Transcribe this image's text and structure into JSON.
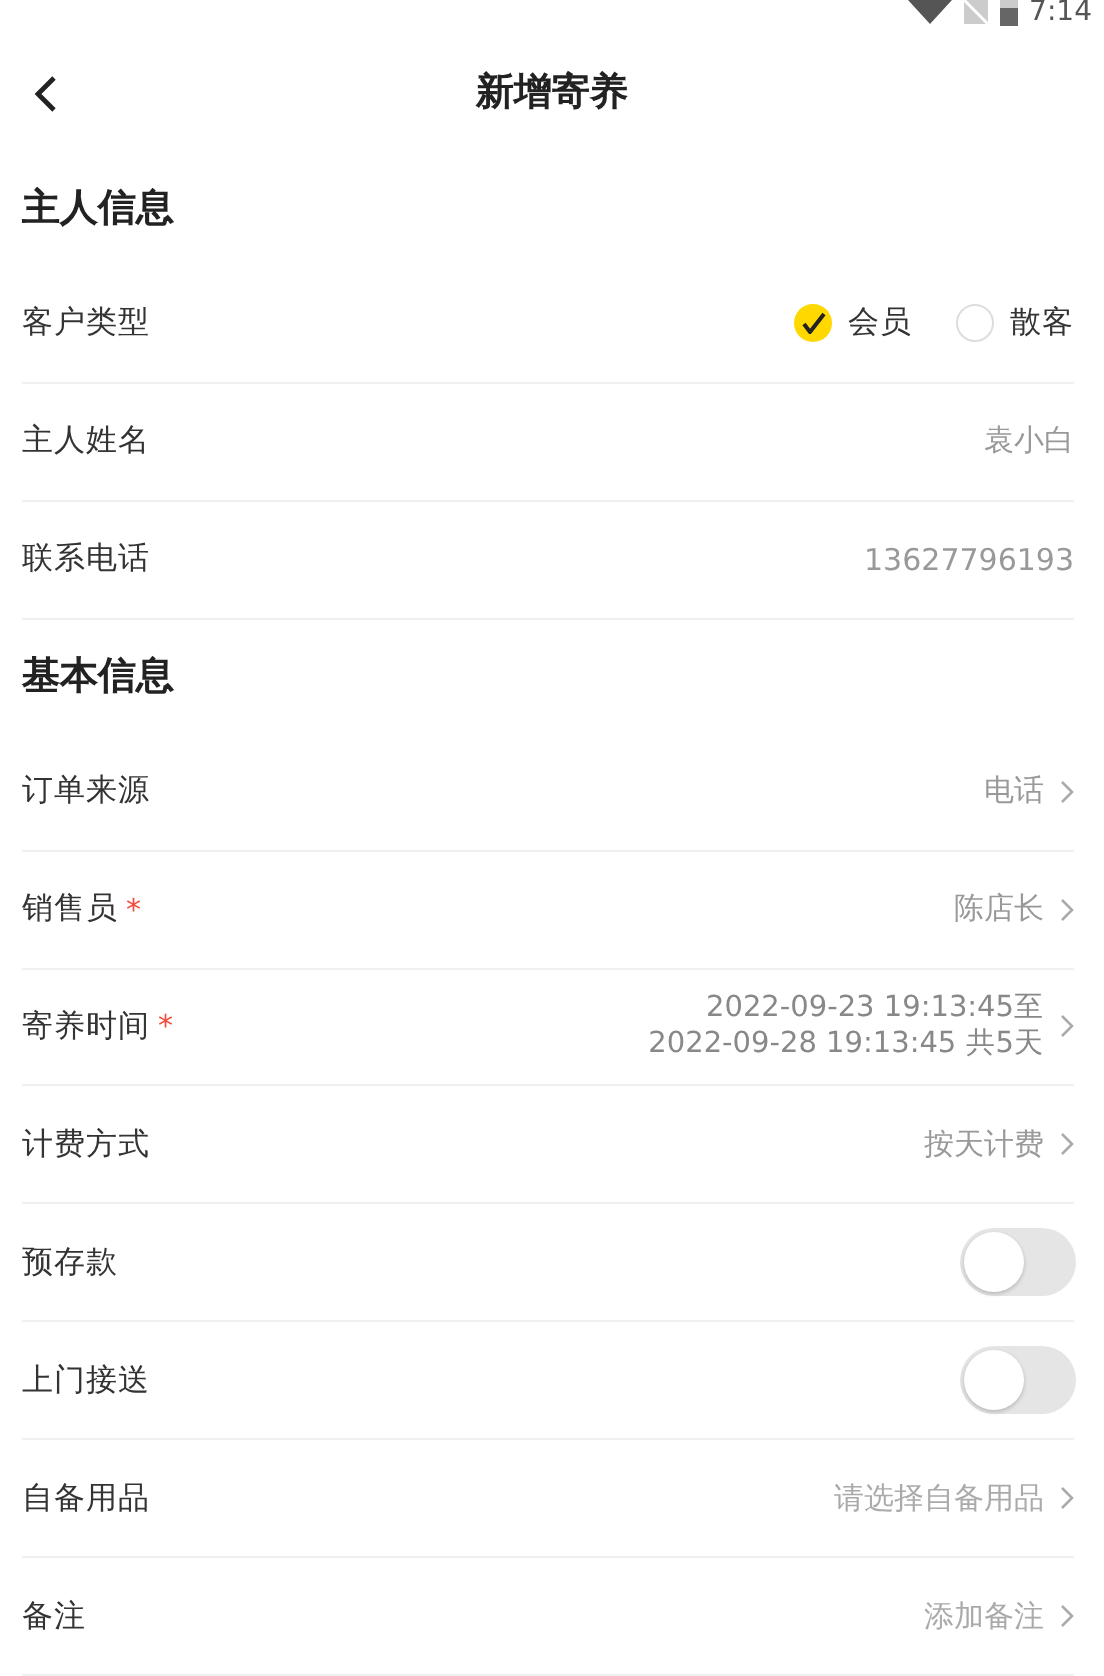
{
  "status_bar": {
    "time": "7:14"
  },
  "header": {
    "title": "新增寄养"
  },
  "sections": [
    {
      "title": "主人信息",
      "rows": [
        {
          "kind": "radio",
          "label": "客户类型",
          "options": [
            {
              "label": "会员",
              "selected": true
            },
            {
              "label": "散客",
              "selected": false
            }
          ]
        },
        {
          "kind": "text",
          "label": "主人姓名",
          "value": "袁小白"
        },
        {
          "kind": "text",
          "label": "联系电话",
          "value": "13627796193"
        }
      ]
    },
    {
      "title": "基本信息",
      "rows": [
        {
          "kind": "link",
          "label": "订单来源",
          "value": "电话"
        },
        {
          "kind": "link",
          "label": "销售员",
          "required_mark": "*",
          "value": "陈店长"
        },
        {
          "kind": "link",
          "label": "寄养时间",
          "required_mark": "*",
          "lines": [
            "2022-09-23 19:13:45至",
            "2022-09-28 19:13:45 共5天"
          ]
        },
        {
          "kind": "link",
          "label": "计费方式",
          "value": "按天计费"
        },
        {
          "kind": "toggle",
          "label": "预存款",
          "on": false
        },
        {
          "kind": "toggle",
          "label": "上门接送",
          "on": false
        },
        {
          "kind": "link",
          "label": "自备用品",
          "placeholder": "请选择自备用品"
        },
        {
          "kind": "link",
          "label": "备注",
          "placeholder": "添加备注"
        }
      ]
    }
  ]
}
